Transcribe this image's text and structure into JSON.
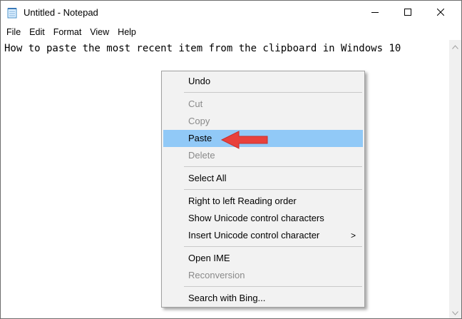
{
  "window": {
    "title": "Untitled - Notepad",
    "icon": "notepad-icon"
  },
  "window_controls": {
    "minimize_icon": "minimize-icon",
    "maximize_icon": "maximize-icon",
    "close_icon": "close-icon"
  },
  "menubar": {
    "items": [
      {
        "label": "File"
      },
      {
        "label": "Edit"
      },
      {
        "label": "Format"
      },
      {
        "label": "View"
      },
      {
        "label": "Help"
      }
    ]
  },
  "editor": {
    "text": "How to paste the most recent item from the clipboard in Windows 10"
  },
  "context_menu": {
    "items": [
      {
        "label": "Undo",
        "enabled": true
      },
      {
        "label": "Cut",
        "enabled": false
      },
      {
        "label": "Copy",
        "enabled": false
      },
      {
        "label": "Paste",
        "enabled": true,
        "highlighted": true
      },
      {
        "label": "Delete",
        "enabled": false
      },
      {
        "label": "Select All",
        "enabled": true
      },
      {
        "label": "Right to left Reading order",
        "enabled": true
      },
      {
        "label": "Show Unicode control characters",
        "enabled": true
      },
      {
        "label": "Insert Unicode control character",
        "enabled": true,
        "submenu_arrow": ">"
      },
      {
        "label": "Open IME",
        "enabled": true
      },
      {
        "label": "Reconversion",
        "enabled": false
      },
      {
        "label": "Search with Bing...",
        "enabled": true
      }
    ]
  },
  "colors": {
    "highlight": "#91c9f7",
    "annotation_arrow": "#e8413c",
    "disabled_text": "#8a8a8a"
  }
}
